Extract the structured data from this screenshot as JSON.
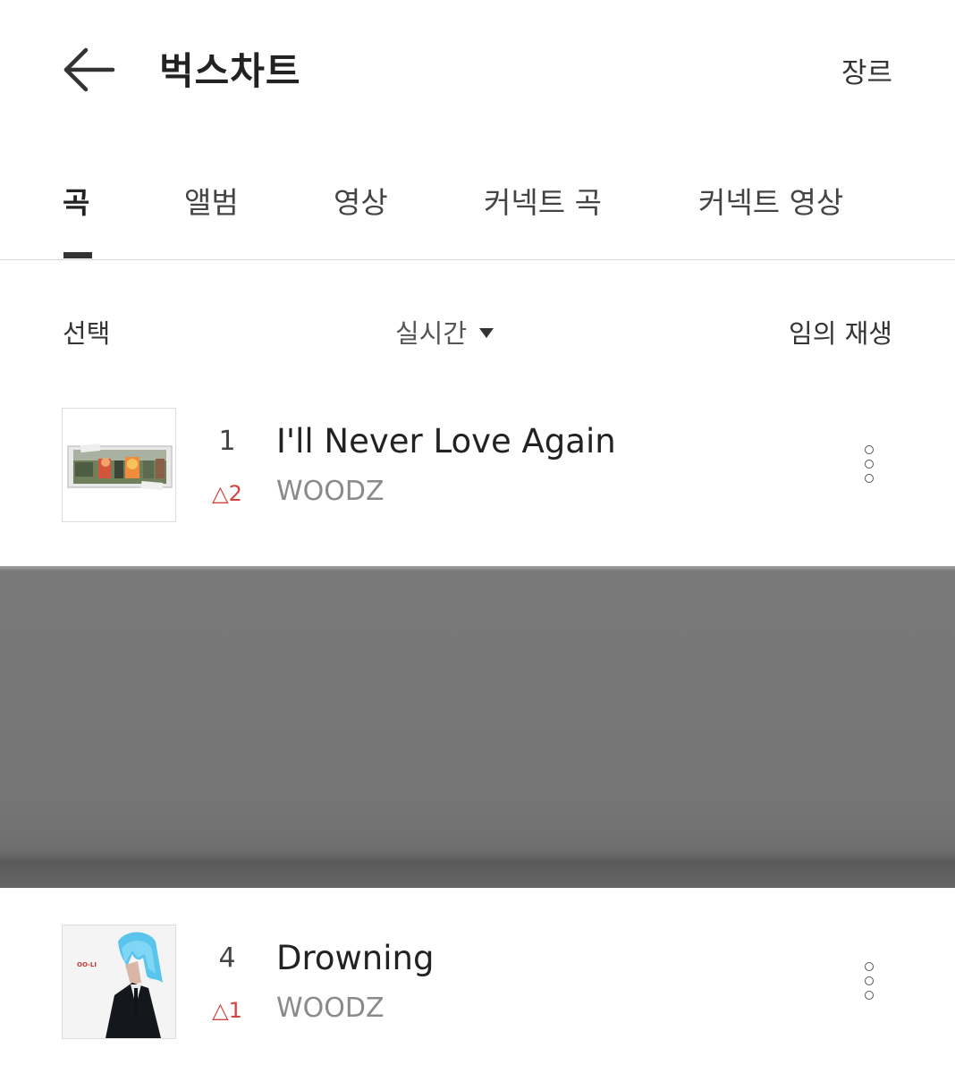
{
  "header": {
    "title": "벅스차트",
    "genre_label": "장르"
  },
  "tabs": [
    {
      "label": "곡",
      "active": true
    },
    {
      "label": "앨범",
      "active": false
    },
    {
      "label": "영상",
      "active": false
    },
    {
      "label": "커넥트 곡",
      "active": false
    },
    {
      "label": "커넥트 영상",
      "active": false
    }
  ],
  "toolbar": {
    "select_label": "선택",
    "sort_label": "실시간",
    "shuffle_label": "임의 재생"
  },
  "tracks": [
    {
      "rank": "1",
      "change": "△2",
      "title": "I'll Never Love Again",
      "artist": "WOODZ"
    },
    {
      "rank": "4",
      "change": "△1",
      "title": "Drowning",
      "artist": "WOODZ",
      "cover_text": "OO-LI"
    }
  ],
  "colors": {
    "rank_up": "#d0453f",
    "artist": "#8a8a8a",
    "tab_indicator": "#333333",
    "redaction": "#767676"
  },
  "icons": {
    "back": "arrow-left-icon",
    "sort": "caret-down-icon",
    "more": "more-vertical-icon"
  }
}
